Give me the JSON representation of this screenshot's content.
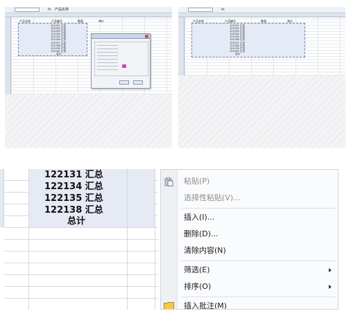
{
  "thumb1": {
    "formula_value": "产品名称",
    "col_header_1": "产品名称",
    "col_header_2": "产品编号",
    "col_header_3": "数量",
    "col_header_4": "单价",
    "rows": [
      "122131 汇总",
      "122132 汇总",
      "122133 汇总",
      "122134 汇总",
      "122135 汇总",
      "122136 汇总",
      "122137 汇总",
      "122138 汇总",
      "122139 汇总",
      "122140 汇总",
      "总计"
    ]
  },
  "thumb2": {
    "col_header_1": "产品名称",
    "col_header_2": "产品编号",
    "col_header_3": "数量",
    "col_header_4": "单价",
    "rows": [
      "122131 汇总",
      "122132 汇总",
      "122133 汇总",
      "122134 汇总",
      "122135 汇总",
      "122136 汇总",
      "122137 汇总",
      "122138 汇总",
      "122139 汇总",
      "122140 汇总",
      "总计"
    ]
  },
  "sheet": {
    "rows": [
      "122131 汇总",
      "122134 汇总",
      "122135 汇总",
      "122138 汇总"
    ],
    "total": "总计"
  },
  "context_menu": {
    "paste": "粘贴(P)",
    "paste_special": "选择性粘贴(V)...",
    "insert": "插入(I)...",
    "delete": "删除(D)...",
    "clear": "清除内容(N)",
    "filter": "筛选(E)",
    "sort": "排序(O)",
    "insert_comment": "插入批注(M)"
  },
  "colors": {
    "selection": "#e5eaf4",
    "menu_bg": "#fafbfc",
    "disabled_text": "#8e8e8e"
  }
}
